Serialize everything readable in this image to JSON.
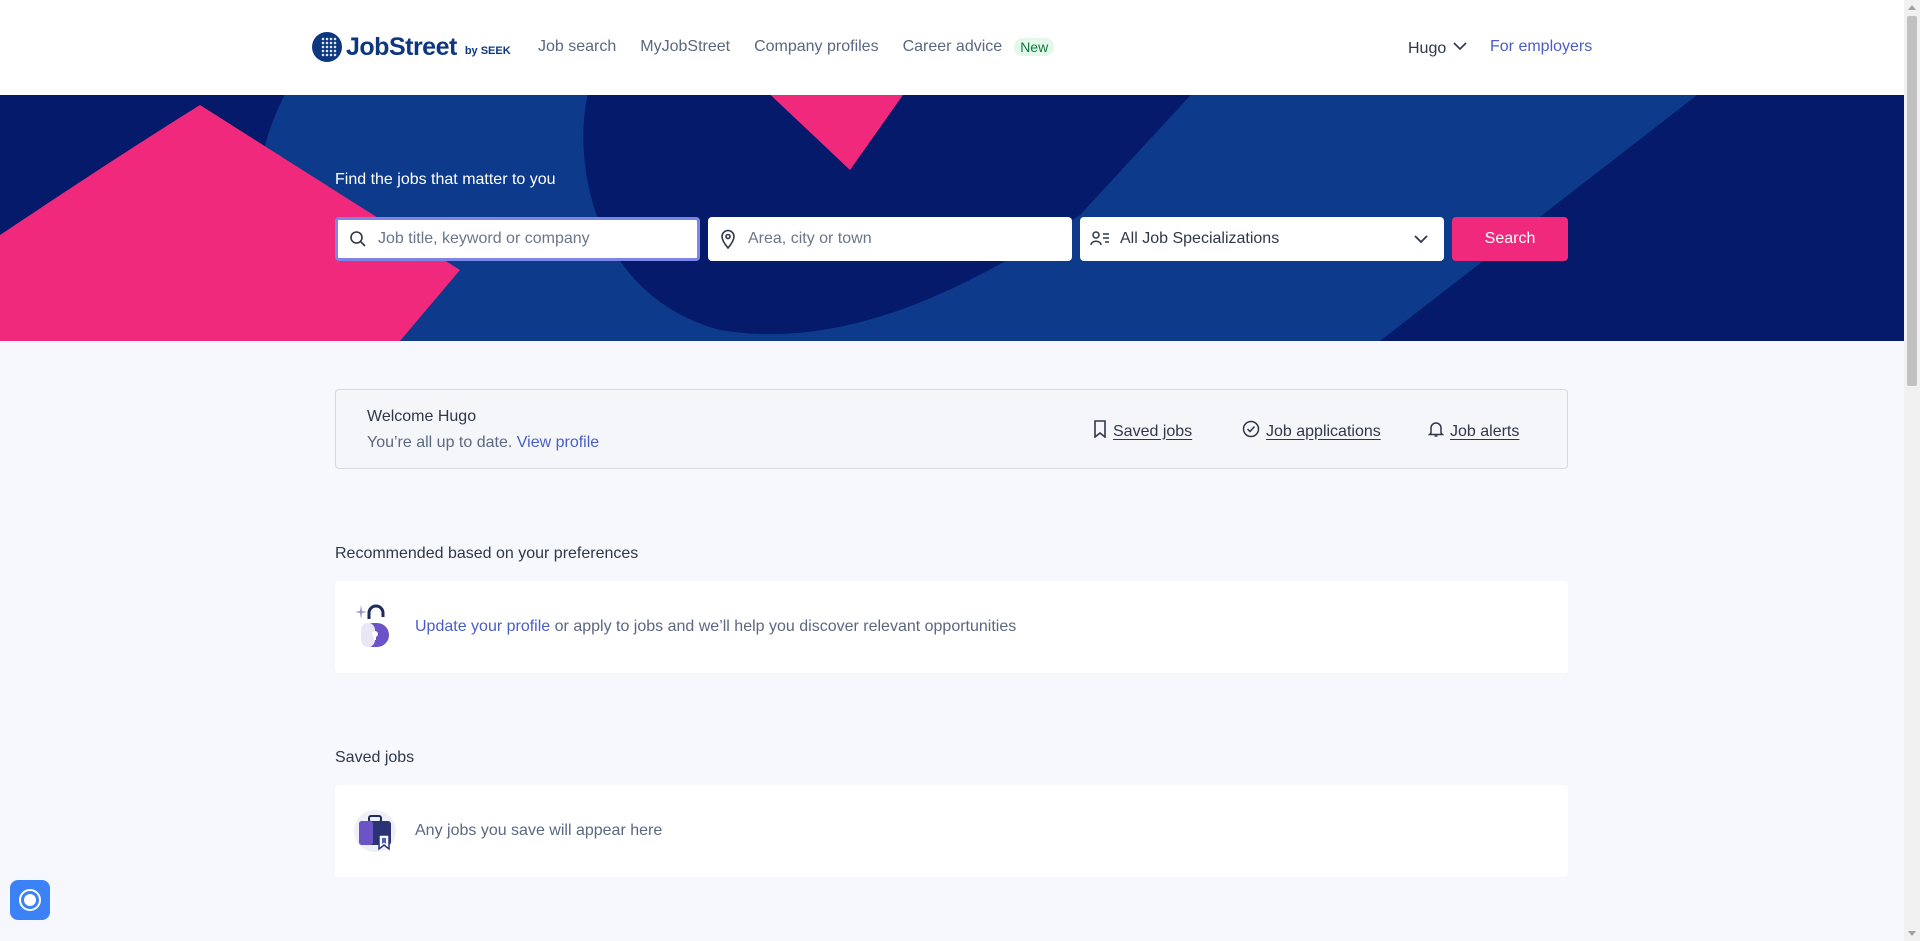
{
  "header": {
    "logo_text": "JobStreet",
    "logo_by": "by SEEK",
    "nav": [
      {
        "label": "Job search"
      },
      {
        "label": "MyJobStreet"
      },
      {
        "label": "Company profiles"
      },
      {
        "label": "Career advice"
      }
    ],
    "new_badge": "New",
    "user_name": "Hugo",
    "employers_link": "For employers"
  },
  "hero": {
    "title": "Find the jobs that matter to you",
    "keyword_placeholder": "Job title, keyword or company",
    "location_placeholder": "Area, city or town",
    "specialization_value": "All Job Specializations",
    "search_button": "Search",
    "colors": {
      "background": "#051a6b",
      "accent": "#f0297c",
      "mid_blue": "#0d3a8a"
    }
  },
  "welcome": {
    "greeting": "Welcome Hugo",
    "status": "You’re all up to date.",
    "view_profile": "View profile",
    "links": [
      {
        "label": "Saved jobs",
        "icon": "bookmark-icon"
      },
      {
        "label": "Job applications",
        "icon": "check-circle-icon"
      },
      {
        "label": "Job alerts",
        "icon": "bell-icon"
      }
    ]
  },
  "recommended": {
    "title": "Recommended based on your preferences",
    "link": "Update your profile",
    "text": "or apply to jobs and we’ll help you discover relevant opportunities"
  },
  "saved_jobs": {
    "title": "Saved jobs",
    "empty_text": "Any jobs you save will appear here"
  }
}
